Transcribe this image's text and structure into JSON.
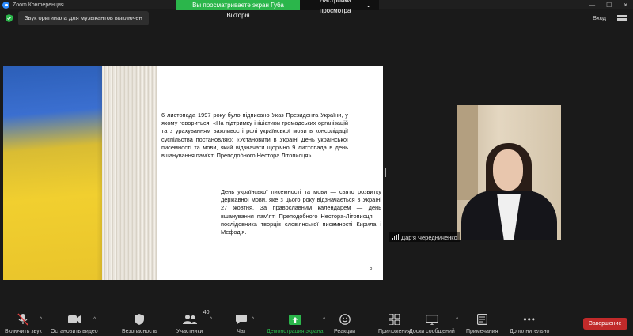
{
  "window": {
    "title": "Zoom Конференция",
    "controls": [
      "—",
      "☐",
      "✕"
    ]
  },
  "share_banner": {
    "viewing_text": "Вы просматриваете экран Губа Вікторія",
    "view_options_label": "Настройки просмотра"
  },
  "top_bar": {
    "audio_status": "Звук оригинала для музыкантов выключен",
    "enter_label": "Вход"
  },
  "slide": {
    "paragraph1": "6 листопада 1997 року було підписано Указ Президента України, у якому говориться: «На підтримку ініціативи громадських організацій та з урахуванням важливості ролі української мови в консолідації суспільства постановляю: «Установити в Україні День української писемності та мови, який відзначати щорічно 9 листопада в день вшанування пам'яті Преподобного Нестора Літописця».",
    "paragraph2": "День української писемності та мови — свято розвитку державної мови, яке з цього року відзначається в Україні 27 жовтня. За православним календарем — день вшанування пам'яті Преподобного Нестора-Літописця — послідовника творців слов'янської писемності Кирила і Мефодія.",
    "page_number": "5"
  },
  "participant": {
    "name": "Дар'я Чередниченко"
  },
  "toolbar": {
    "mute_label": "Включить звук",
    "video_label": "Остановить видео",
    "security_label": "Безопасность",
    "participants_label": "Участники",
    "participants_count": "40",
    "chat_label": "Чат",
    "share_label": "Демонстрация экрана",
    "reactions_label": "Реакции",
    "apps_label": "Приложения",
    "whiteboard_label": "Доски сообщений",
    "notes_label": "Примечания",
    "more_label": "Дополнительно",
    "end_label": "Завершение"
  },
  "colors": {
    "share_green": "#2bb64b",
    "end_red": "#c12a2a",
    "zoom_blue": "#2d8cff"
  }
}
